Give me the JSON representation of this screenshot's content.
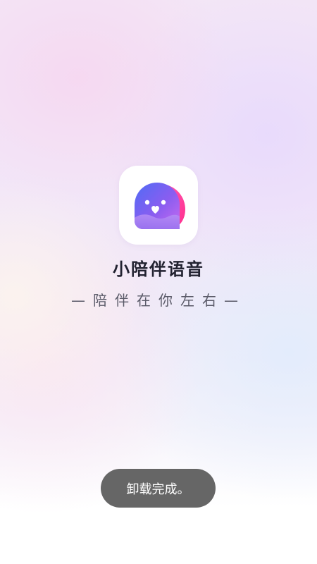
{
  "app": {
    "name": "小陪伴语音",
    "slogan": "—陪伴在你左右—",
    "icon": "app-logo-icon"
  },
  "toast": {
    "message": "卸载完成。"
  },
  "colors": {
    "logo_gradient_start": "#4f6cf5",
    "logo_gradient_mid": "#8a5df0",
    "logo_gradient_end": "#e05ee0",
    "logo_accent": "#ff3da0",
    "toast_background": "#666666"
  }
}
